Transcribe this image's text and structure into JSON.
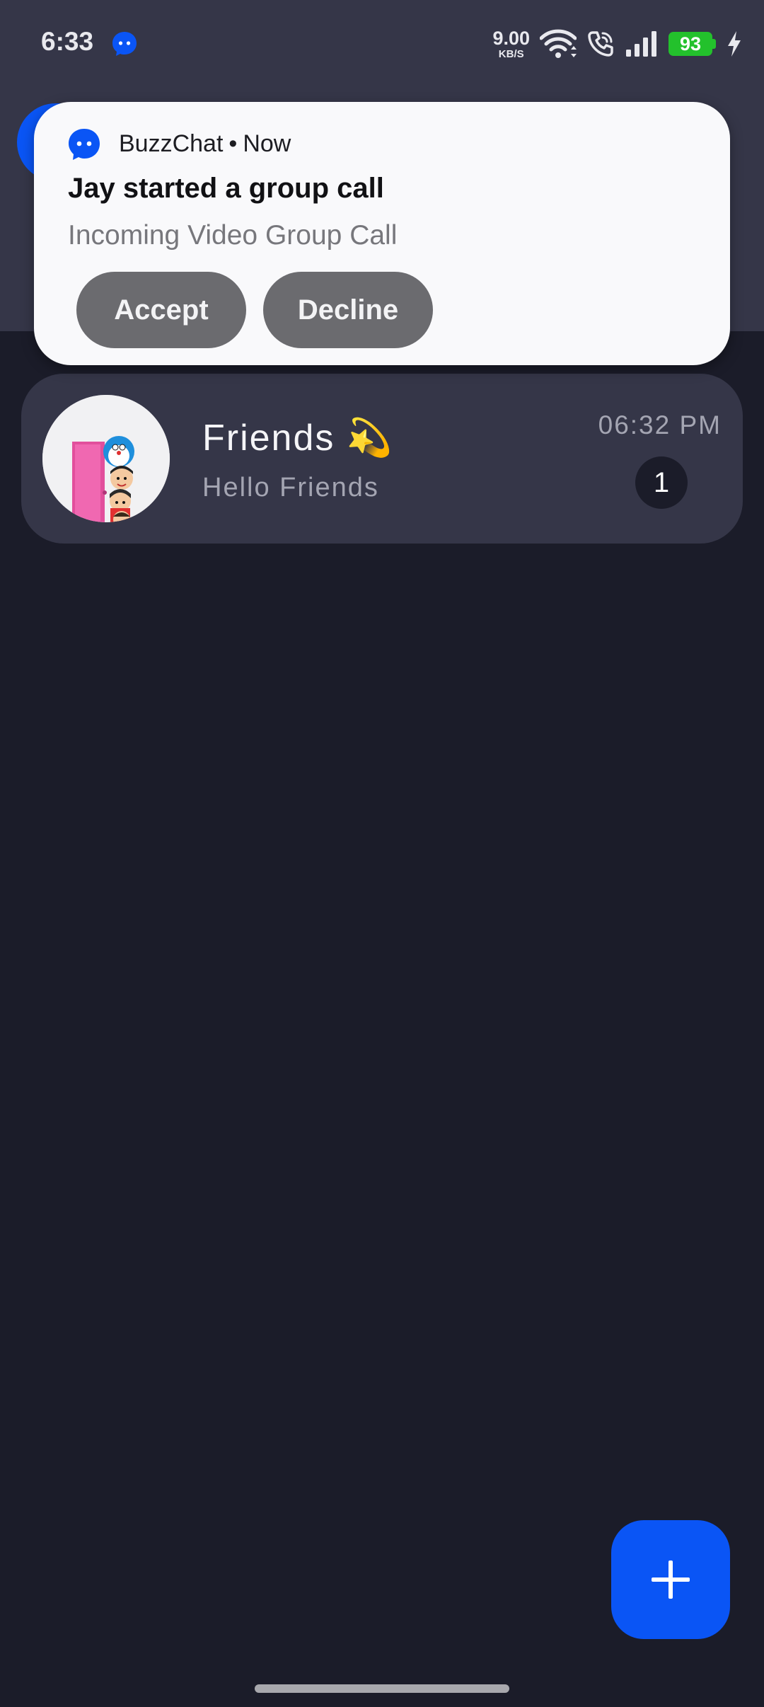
{
  "status_bar": {
    "time": "6:33",
    "net_speed_value": "9.00",
    "net_speed_unit": "KB/S",
    "battery_level": "93",
    "icons": [
      "buzzchat-notification-icon",
      "wifi-icon",
      "wifi-calling-icon",
      "signal-icon",
      "battery-icon",
      "charging-icon"
    ]
  },
  "notification": {
    "app_name": "BuzzChat",
    "separator": "•",
    "time": "Now",
    "title": "Jay started a group call",
    "text": "Incoming Video Group Call",
    "actions": {
      "accept": "Accept",
      "decline": "Decline"
    }
  },
  "chat_list": [
    {
      "name": "Friends 💫",
      "preview": "Hello Friends",
      "time": "06:32 PM",
      "unread": "1"
    }
  ],
  "fab": {
    "icon": "plus-icon"
  },
  "colors": {
    "background": "#1b1c29",
    "header": "#353648",
    "accent": "#0a55f5",
    "card": "#353648",
    "notification_bg": "#f9f9fb",
    "notification_button": "#6b6b6f",
    "battery": "#23c12c"
  }
}
